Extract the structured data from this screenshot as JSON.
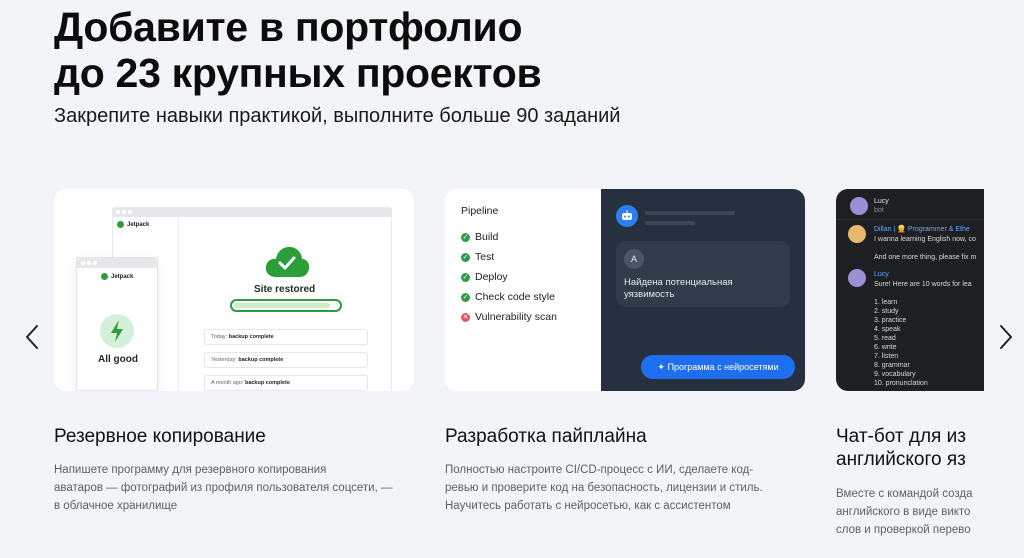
{
  "header": {
    "title_line1": "Добавите в портфолио",
    "title_line2": "до 23 крупных проектов",
    "subtitle": "Закрепите навыки практикой, выполните больше 90 заданий"
  },
  "nav": {
    "prev_icon": "chevron-left-icon",
    "next_icon": "chevron-right-icon"
  },
  "cards": [
    {
      "title": "Резервное копирование",
      "desc": [
        "Напишете программу для резервного копирования",
        "аватаров — фотографий из профиля пользователя соцсети, —",
        "в облачное хранилище"
      ],
      "mock": {
        "brand": "Jetpack",
        "status": "Site restored",
        "progress": 0.92,
        "badge": "All good",
        "logs": [
          {
            "when": "Today:",
            "what": "backup complete"
          },
          {
            "when": "Yesterday:",
            "what": "backup complete"
          },
          {
            "when": "A month ago:",
            "what": "backup complete"
          }
        ]
      }
    },
    {
      "title": "Разработка пайплайна",
      "desc": [
        "Полностью настроите CI/CD-процесс с ИИ, сделаете код-",
        "ревью и проверите код на безопасность, лицензии и стиль.",
        "Научитесь работать с нейросетью, как с ассистентом"
      ],
      "mock": {
        "pipeline_title": "Pipeline",
        "steps": [
          {
            "label": "Build",
            "status": "ok"
          },
          {
            "label": "Test",
            "status": "ok"
          },
          {
            "label": "Deploy",
            "status": "ok"
          },
          {
            "label": "Check code style",
            "status": "ok"
          },
          {
            "label": "Vulnerability scan",
            "status": "fail"
          }
        ],
        "avatar_letter": "A",
        "message": "Найдена потенциальная уязвимость",
        "button": "Программа с нейросетями",
        "colors": {
          "accent": "#1e6ff0",
          "panel": "#26303e",
          "ok": "#2e9e4a",
          "fail": "#e8545b"
        }
      }
    },
    {
      "title_line1": "Чат-бот для из",
      "title_line2": "английского яз",
      "desc": [
        "Вместе с командой созда",
        "английского в виде викто",
        "слов и проверкой перево"
      ],
      "mock": {
        "bot_name": "Lucy",
        "bot_sub": "bot",
        "user_name": "Dillan | 👱 Programmer & Ethe",
        "user_msg1": "I wanna learning English now, co",
        "user_msg2": "And one more thing, please fix m",
        "reply_name": "Lucy",
        "reply_msg": "Sure! Here are 10 words for lea",
        "words": [
          "1. learn",
          "2. study",
          "3. practice",
          "4. speak",
          "5. read",
          "6. write",
          "7. listen",
          "8. grammar",
          "9. vocabulary",
          "10. pronunclation"
        ]
      }
    }
  ]
}
